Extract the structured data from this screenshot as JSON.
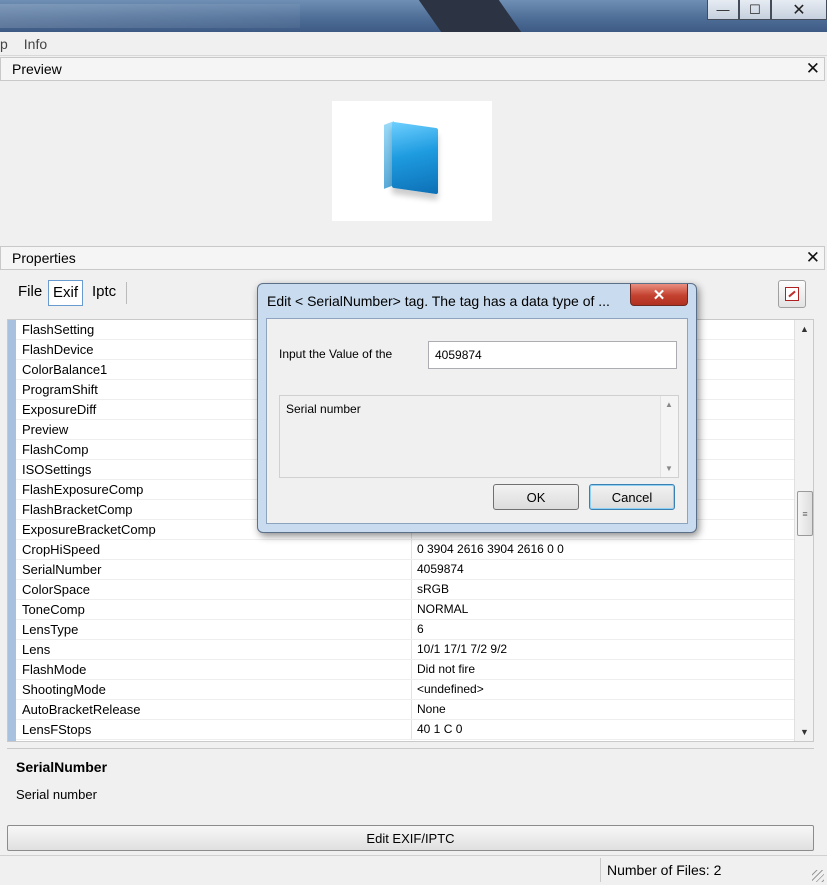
{
  "menu": {
    "items": [
      "p",
      "Info"
    ]
  },
  "preview_panel": {
    "title": "Preview",
    "close": "✕"
  },
  "properties_panel": {
    "title": "Properties",
    "close": "✕"
  },
  "tabs": [
    {
      "label": "File",
      "active": false
    },
    {
      "label": "Exif",
      "active": true
    },
    {
      "label": "Iptc",
      "active": false
    }
  ],
  "rows": [
    {
      "name": "FlashSetting",
      "value": ""
    },
    {
      "name": "FlashDevice",
      "value": ""
    },
    {
      "name": "ColorBalance1",
      "value": ""
    },
    {
      "name": "ProgramShift",
      "value": ""
    },
    {
      "name": "ExposureDiff",
      "value": ""
    },
    {
      "name": "Preview",
      "value": ""
    },
    {
      "name": "FlashComp",
      "value": ""
    },
    {
      "name": "ISOSettings",
      "value": ""
    },
    {
      "name": "FlashExposureComp",
      "value": ""
    },
    {
      "name": "FlashBracketComp",
      "value": ""
    },
    {
      "name": "ExposureBracketComp",
      "value": ""
    },
    {
      "name": "CropHiSpeed",
      "value": "0 3904 2616 3904 2616 0 0"
    },
    {
      "name": "SerialNumber",
      "value": "4059874"
    },
    {
      "name": "ColorSpace",
      "value": "sRGB"
    },
    {
      "name": "ToneComp",
      "value": "NORMAL"
    },
    {
      "name": "LensType",
      "value": "6"
    },
    {
      "name": "Lens",
      "value": "10/1 17/1 7/2 9/2"
    },
    {
      "name": "FlashMode",
      "value": "Did not fire"
    },
    {
      "name": "ShootingMode",
      "value": "<undefined>"
    },
    {
      "name": "AutoBracketRelease",
      "value": "None"
    },
    {
      "name": "LensFStops",
      "value": "40  1  C  0"
    }
  ],
  "description": {
    "title": "SerialNumber",
    "text": "Serial number"
  },
  "edit_button": "Edit EXIF/IPTC",
  "status": {
    "files": "Number of Files: 2"
  },
  "dialog": {
    "title": "Edit < SerialNumber> tag. The tag has a data type of ...",
    "close": "✕",
    "input_label": "Input the Value of the",
    "input_value": "4059874",
    "description": "Serial number",
    "ok": "OK",
    "cancel": "Cancel"
  },
  "window_buttons": {
    "minimize": "—",
    "maximize": "☐",
    "close": "✕"
  },
  "colors": {
    "accent": "#6a9bd0",
    "close_red": "#c4412f",
    "grid_marker": "#a8c1de"
  }
}
